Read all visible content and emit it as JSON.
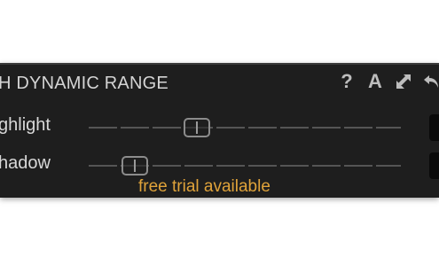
{
  "panel": {
    "title": "H DYNAMIC RANGE",
    "icons": {
      "help": "?",
      "auto": "A",
      "expand": "expand-icon",
      "reset": "reset-icon"
    }
  },
  "sliders": [
    {
      "label": "ghlight",
      "knob_position": 0.35
    },
    {
      "label": "hadow",
      "knob_position": 0.15
    }
  ],
  "banner": {
    "text": "free trial available",
    "color": "#e0a33a"
  },
  "colors": {
    "panel_background": "#1e1e1e",
    "text": "#d8d8d8",
    "accent": "#e0a33a"
  }
}
